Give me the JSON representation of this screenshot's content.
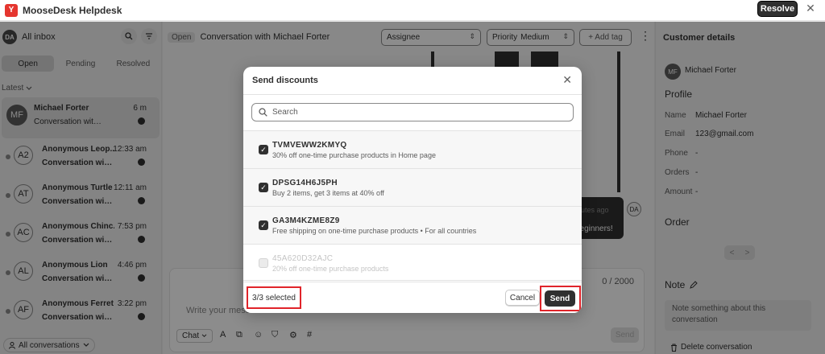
{
  "app": {
    "title": "MooseDesk Helpdesk",
    "logo_letter": "Y",
    "resolve_label": "Resolve",
    "close_glyph": "✕"
  },
  "inbox": {
    "avatar_initials": "DA",
    "title": "All inbox",
    "tabs": [
      {
        "label": "Open",
        "active": true
      },
      {
        "label": "Pending",
        "active": false
      },
      {
        "label": "Resolved",
        "active": false
      }
    ],
    "sort_label": "Latest",
    "conversations": [
      {
        "initials": "MF",
        "name": "Michael Forter",
        "time": "6 m",
        "preview": "Conversation with ...",
        "selected": true,
        "unread": false
      },
      {
        "initials": "A2",
        "name": "Anonymous Leop...",
        "time": "12:33 am",
        "preview": "Conversation with...",
        "selected": false,
        "unread": true
      },
      {
        "initials": "AT",
        "name": "Anonymous Turtle",
        "time": "12:11 am",
        "preview": "Conversation with...",
        "selected": false,
        "unread": true
      },
      {
        "initials": "AC",
        "name": "Anonymous Chinc...",
        "time": "7:53 pm",
        "preview": "Conversation with...",
        "selected": false,
        "unread": true
      },
      {
        "initials": "AL",
        "name": "Anonymous Lion",
        "time": "4:46 pm",
        "preview": "Conversation with...",
        "selected": false,
        "unread": true
      },
      {
        "initials": "AF",
        "name": "Anonymous Ferret",
        "time": "3:22 pm",
        "preview": "Conversation with...",
        "selected": false,
        "unread": true
      }
    ],
    "filter_label": "All conversations"
  },
  "conversation": {
    "status_badge": "Open",
    "title": "Conversation with Michael Forter",
    "assignee_label": "Assignee",
    "priority_label": "Priority",
    "priority_value": "Medium",
    "add_tag_label": "+ Add tag",
    "kebab_glyph": "⋮",
    "bubble_time": "nutes ago",
    "bubble_text": "beginners!",
    "bubble_avatar": "DA",
    "reply_placeholder": "Write your mess",
    "char_count": "0 / 2000",
    "channel_select": "Chat",
    "send_label": "Send"
  },
  "customer": {
    "panel_title": "Customer details",
    "avatar_initials": "MF",
    "name": "Michael Forter",
    "profile_heading": "Profile",
    "fields": [
      {
        "label": "Name",
        "value": "Michael Forter"
      },
      {
        "label": "Email",
        "value": "123@gmail.com"
      },
      {
        "label": "Phone",
        "value": "-"
      },
      {
        "label": "Orders",
        "value": "-"
      },
      {
        "label": "Amount",
        "value": "-"
      }
    ],
    "order_heading": "Order",
    "pager_prev": "<",
    "pager_next": ">",
    "note_heading": "Note",
    "note_placeholder": "Note something about this conversation",
    "delete_label": "Delete conversation"
  },
  "modal": {
    "title": "Send discounts",
    "close_glyph": "✕",
    "search_placeholder": "Search",
    "discounts": [
      {
        "code": "TVMVEWW2KMYQ",
        "description": "30% off one-time purchase products in Home page",
        "checked": true,
        "disabled": false
      },
      {
        "code": "DPSG14H6J5PH",
        "description": "Buy 2 items, get 3 items at 40% off",
        "checked": true,
        "disabled": false
      },
      {
        "code": "GA3M4KZME8Z9",
        "description": "Free shipping on one-time purchase products • For all countries",
        "checked": true,
        "disabled": false
      },
      {
        "code": "45A620D32AJC",
        "description": "20% off one-time purchase products",
        "checked": false,
        "disabled": true
      }
    ],
    "selected_count": "3/3 selected",
    "cancel_label": "Cancel",
    "send_label": "Send",
    "highlight_color": "#e0242a"
  }
}
